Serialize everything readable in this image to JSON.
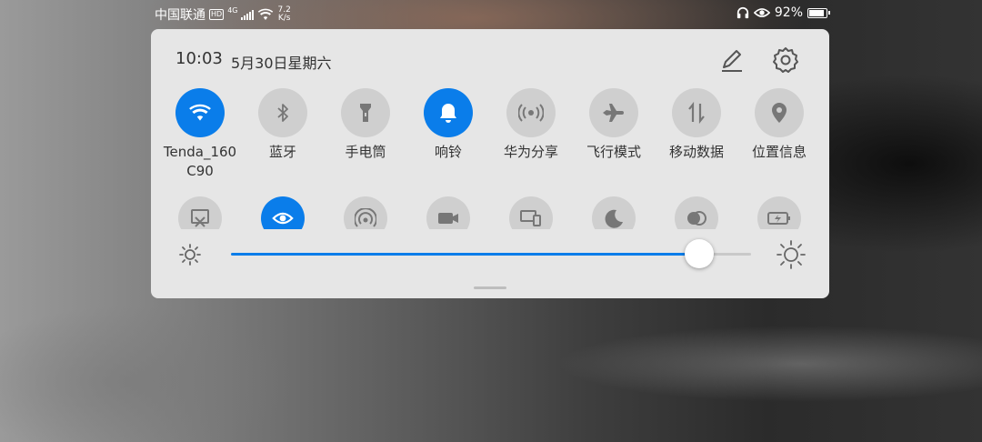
{
  "status_bar": {
    "carrier": "中国联通",
    "hd_badge": "HD",
    "network_type": "4G",
    "speed_value": "7.2",
    "speed_unit": "K/s",
    "battery": "92%",
    "battery_level": 0.92,
    "icons": [
      "signal-icon",
      "wifi-icon",
      "headphones-icon",
      "eye-comfort-icon",
      "battery-icon"
    ]
  },
  "panel": {
    "time": "10:03",
    "date": "5月30日星期六",
    "edit_icon": "pencil-icon",
    "settings_icon": "gear-icon"
  },
  "tiles": [
    {
      "label": "Tenda_160\nC90",
      "icon": "wifi-icon",
      "active": true
    },
    {
      "label": "蓝牙",
      "icon": "bluetooth-icon",
      "active": false
    },
    {
      "label": "手电筒",
      "icon": "flashlight-icon",
      "active": false
    },
    {
      "label": "响铃",
      "icon": "bell-icon",
      "active": true
    },
    {
      "label": "华为分享",
      "icon": "share-icon",
      "active": false
    },
    {
      "label": "飞行模式",
      "icon": "airplane-icon",
      "active": false
    },
    {
      "label": "移动数据",
      "icon": "mobile-data-icon",
      "active": false
    },
    {
      "label": "位置信息",
      "icon": "location-icon",
      "active": false
    }
  ],
  "tiles_row2": [
    {
      "icon": "screenshot-icon",
      "active": false
    },
    {
      "icon": "eye-comfort-icon",
      "active": true
    },
    {
      "icon": "hotspot-icon",
      "active": false
    },
    {
      "icon": "screen-record-icon",
      "active": false
    },
    {
      "icon": "multi-screen-icon",
      "active": false
    },
    {
      "icon": "moon-icon",
      "active": false
    },
    {
      "icon": "dark-mode-icon",
      "active": false
    },
    {
      "icon": "battery-saver-icon",
      "active": false
    }
  ],
  "brightness": {
    "level": 0.9
  },
  "colors": {
    "accent": "#0a7dea",
    "tile_off": "#cfcfcf",
    "panel_bg": "#e6e6e6"
  }
}
